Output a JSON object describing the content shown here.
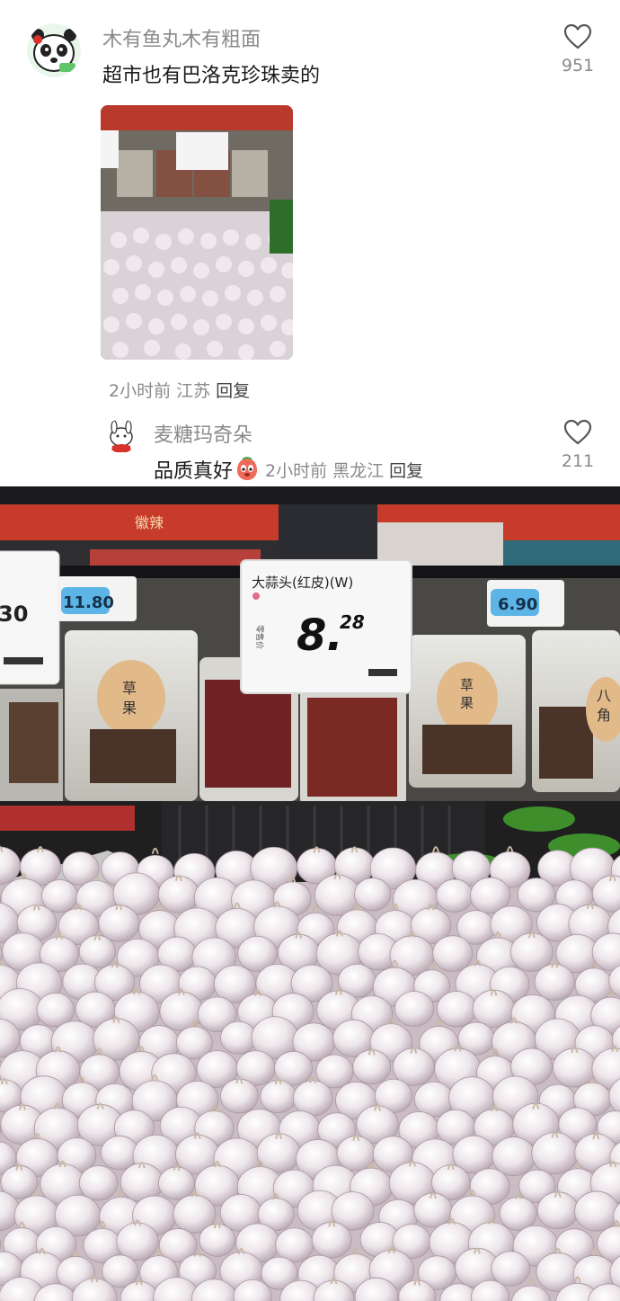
{
  "comment_1": {
    "username": "木有鱼丸木有粗面",
    "text": "超市也有巴洛克珍珠卖的",
    "like_count": "951",
    "time": "2小时前",
    "location": "江苏",
    "reply_label": "回复"
  },
  "comment_2": {
    "username": "麦糖玛奇朵",
    "text": "品质真好",
    "like_count": "211",
    "time": "2小时前",
    "location": "黑龙江",
    "reply_label": "回复"
  },
  "photo": {
    "product_tag_name": "大蒜头(红皮)(W)",
    "product_tag_price_int": "8.",
    "product_tag_price_dec": "28",
    "left_tag_price": "11.80",
    "right_tag_price": "6.90",
    "edge_tag_price": "30",
    "bag_label_1": "草",
    "bag_label_2": "果",
    "bag_label_3": "八",
    "bag_label_4": "角",
    "shelf_sign": "徽辣",
    "small_tag": "零售价"
  },
  "colors": {
    "username": "#8a8a8a",
    "text": "#1a1a1a",
    "meta": "#8a8a8a"
  }
}
